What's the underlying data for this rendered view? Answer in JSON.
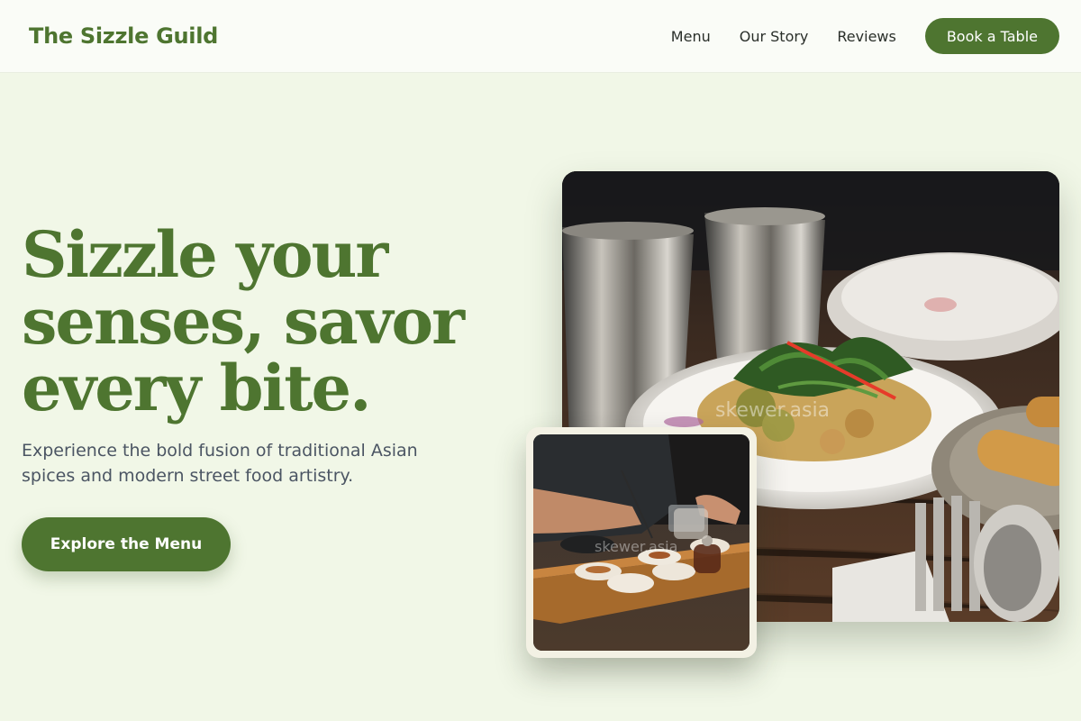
{
  "brand": {
    "name": "The Sizzle Guild"
  },
  "nav": {
    "links": [
      "Menu",
      "Our Story",
      "Reviews"
    ],
    "cta_label": "Book a Table"
  },
  "hero": {
    "title_line1": "Sizzle your",
    "title_line2": "senses, savor",
    "title_line3": "every bite.",
    "subtitle": "Experience the bold fusion of traditional Asian spices and modern street food artistry.",
    "cta_label": "Explore the Menu"
  },
  "images": {
    "main_watermark": "skewer.asia",
    "small_watermark": "skewer.asia"
  },
  "colors": {
    "accent": "#4e7530",
    "background": "#f1f7e7",
    "header_bg": "#fafcf7"
  }
}
